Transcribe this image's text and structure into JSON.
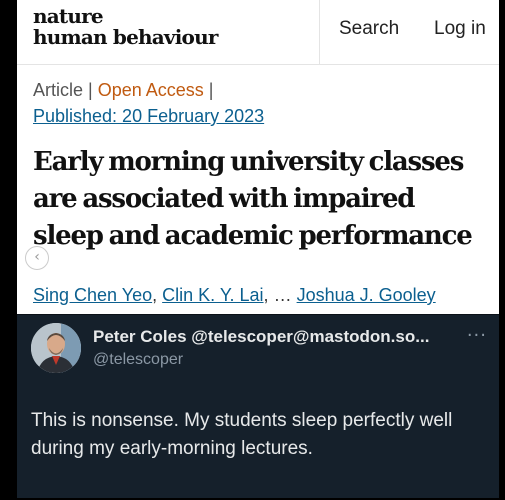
{
  "header": {
    "logo_line1": "nature",
    "logo_line2": "human behaviour",
    "search_label": "Search",
    "login_label": "Log in"
  },
  "article": {
    "type": "Article",
    "access": "Open Access",
    "published": "Published: 20 February 2023",
    "title_lines": [
      "Early morning university classes",
      "are associated with impaired",
      "sleep and academic performance"
    ],
    "authors": [
      "Sing Chen Yeo",
      "Clin K. Y. Lai",
      "Joshua J. Gooley"
    ],
    "author_separator": ",",
    "author_ellipsis": "…",
    "carousel_icon": "chevron-left-icon"
  },
  "post": {
    "display_name": "Peter Coles @telescoper@mastodon.so...",
    "handle": "@telescoper",
    "more_icon": "more-dots-icon",
    "more_glyph": "···",
    "text": "This is nonsense. My students sleep perfectly well during my early-morning lectures."
  },
  "colors": {
    "background": "#000000",
    "link": "#0b5f8f",
    "open_access": "#c05a10",
    "post_bg": "#15202b",
    "post_text": "#e7e9ea",
    "post_muted": "#8b98a5"
  }
}
